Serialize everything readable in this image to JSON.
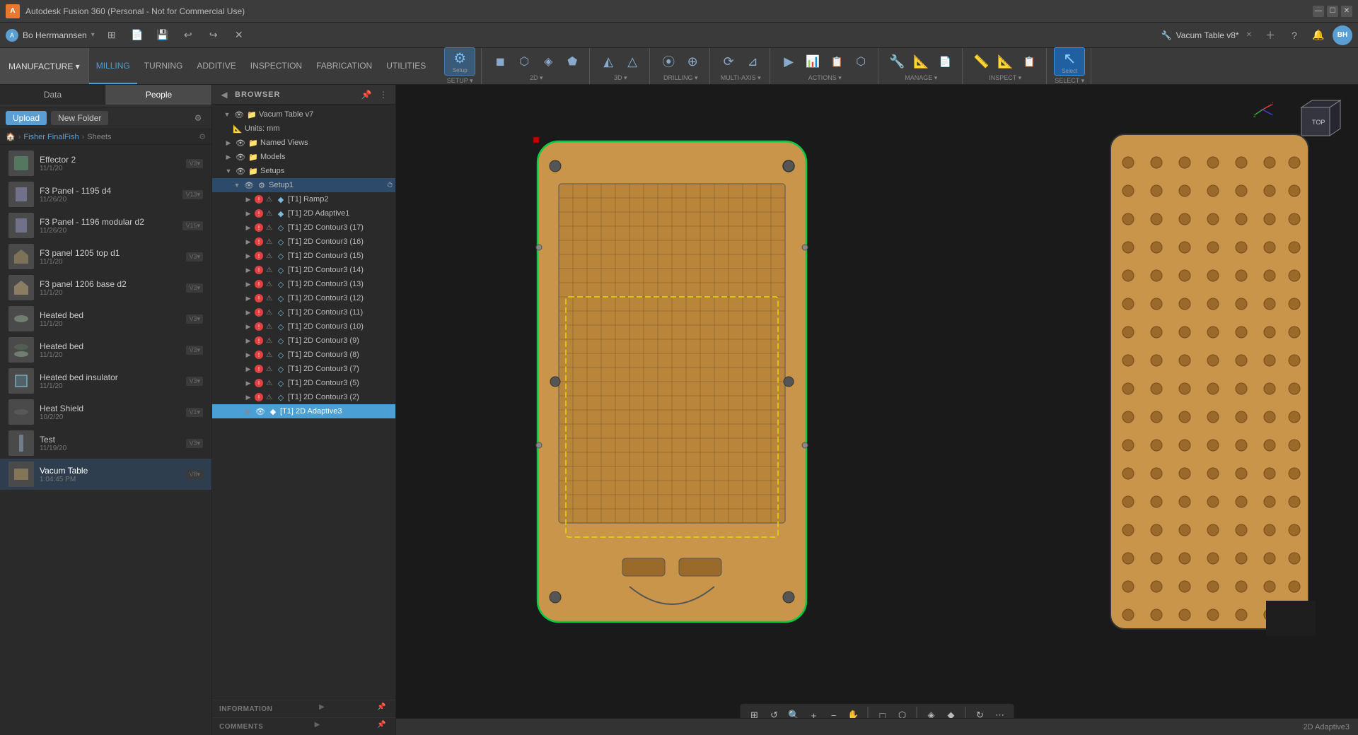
{
  "titleBar": {
    "appName": "Autodesk Fusion 360 (Personal - Not for Commercial Use)",
    "controls": [
      "—",
      "☐",
      "✕"
    ]
  },
  "appBar": {
    "user": "Bo Herrmannsen",
    "docTitle": "Vacum Table v8*",
    "icons": [
      "grid",
      "file",
      "save",
      "undo",
      "redo",
      "close"
    ],
    "rightIcons": [
      "plus",
      "question",
      "bell"
    ],
    "userBadge": "BH"
  },
  "ribbon": {
    "workspaceBtn": "MANUFACTURE ▾",
    "tabs": [
      {
        "label": "MILLING",
        "active": true
      },
      {
        "label": "TURNING",
        "active": false
      },
      {
        "label": "ADDITIVE",
        "active": false
      },
      {
        "label": "INSPECTION",
        "active": false
      },
      {
        "label": "FABRICATION",
        "active": false
      },
      {
        "label": "UTILITIES",
        "active": false
      }
    ],
    "groups": [
      {
        "label": "SETUP",
        "buttons": [
          "Setup"
        ]
      },
      {
        "label": "2D",
        "buttons": [
          "2D"
        ]
      },
      {
        "label": "3D",
        "buttons": [
          "3D"
        ]
      },
      {
        "label": "DRILLING",
        "buttons": [
          "Drill"
        ]
      },
      {
        "label": "MULTI-AXIS",
        "buttons": [
          "Multi"
        ]
      },
      {
        "label": "ACTIONS",
        "buttons": [
          "Actions"
        ]
      },
      {
        "label": "MANAGE",
        "buttons": [
          "Manage"
        ]
      },
      {
        "label": "INSPECT",
        "buttons": [
          "Inspect"
        ]
      },
      {
        "label": "SELECT",
        "buttons": [
          "Select"
        ]
      }
    ]
  },
  "leftPanel": {
    "tabs": [
      "Data",
      "People"
    ],
    "uploadBtn": "Upload",
    "newFolderBtn": "New Folder",
    "breadcrumb": [
      "🏠",
      "Fisher FinalFish",
      "Sheets"
    ],
    "files": [
      {
        "name": "Effector 2",
        "date": "11/1/20",
        "version": "V3"
      },
      {
        "name": "F3 Panel - 1195 d4",
        "date": "11/26/20",
        "version": "V13"
      },
      {
        "name": "F3 Panel - 1196 modular d2",
        "date": "11/26/20",
        "version": "V15"
      },
      {
        "name": "F3 panel 1205 top d1",
        "date": "11/1/20",
        "version": "V3"
      },
      {
        "name": "F3 panel 1206 base d2",
        "date": "11/1/20",
        "version": "V3"
      },
      {
        "name": "Heated bed",
        "date": "11/1/20",
        "version": "V3"
      },
      {
        "name": "Heated bed",
        "date": "11/1/20",
        "version": "V3"
      },
      {
        "name": "Heated bed insulator",
        "date": "11/1/20",
        "version": "V3"
      },
      {
        "name": "Heat Shield",
        "date": "10/2/20",
        "version": "V1"
      },
      {
        "name": "Test",
        "date": "11/19/20",
        "version": "V3"
      },
      {
        "name": "Vacum Table",
        "date": "1:04:45 PM",
        "version": "V8"
      }
    ]
  },
  "browser": {
    "label": "BROWSER",
    "collapseBtn": "◀",
    "pinBtn": "📌",
    "tree": {
      "rootName": "Vacum Table v7",
      "units": "Units: mm",
      "namedViews": "Named Views",
      "models": "Models",
      "setups": "Setups",
      "setup1": "Setup1",
      "operations": [
        {
          "label": "[T1] Ramp2",
          "error": true,
          "indent": 4
        },
        {
          "label": "[T1] 2D Adaptive1",
          "error": true,
          "indent": 4
        },
        {
          "label": "[T1] 2D Contour3 (17)",
          "error": true,
          "indent": 4
        },
        {
          "label": "[T1] 2D Contour3 (16)",
          "error": true,
          "indent": 4
        },
        {
          "label": "[T1] 2D Contour3 (15)",
          "error": true,
          "indent": 4
        },
        {
          "label": "[T1] 2D Contour3 (14)",
          "error": true,
          "indent": 4
        },
        {
          "label": "[T1] 2D Contour3 (13)",
          "error": true,
          "indent": 4
        },
        {
          "label": "[T1] 2D Contour3 (12)",
          "error": true,
          "indent": 4
        },
        {
          "label": "[T1] 2D Contour3 (11)",
          "error": true,
          "indent": 4
        },
        {
          "label": "[T1] 2D Contour3 (10)",
          "error": true,
          "indent": 4
        },
        {
          "label": "[T1] 2D Contour3 (9)",
          "error": true,
          "indent": 4
        },
        {
          "label": "[T1] 2D Contour3 (8)",
          "error": true,
          "indent": 4
        },
        {
          "label": "[T1] 2D Contour3 (7)",
          "error": true,
          "indent": 4
        },
        {
          "label": "[T1] 2D Contour3 (5)",
          "error": true,
          "indent": 4
        },
        {
          "label": "[T1] 2D Contour3 (2)",
          "error": true,
          "indent": 4
        },
        {
          "label": "[T1] 2D Adaptive3",
          "error": false,
          "indent": 4,
          "selected": true
        }
      ]
    }
  },
  "bottomPanels": [
    {
      "label": "INFORMATION"
    },
    {
      "label": "COMMENTS"
    }
  ],
  "statusBar": {
    "rightText": "2D Adaptive3"
  },
  "viewCube": {
    "label": "TOP"
  }
}
